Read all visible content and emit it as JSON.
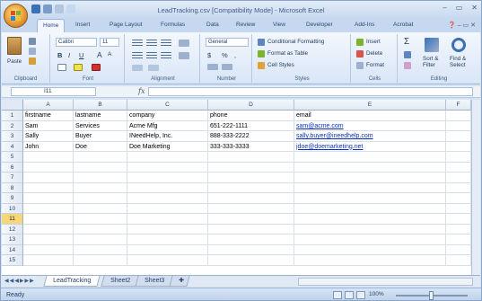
{
  "window": {
    "title": "LeadTracking.csv [Compatibility Mode] - Microsoft Excel",
    "controls": [
      "–",
      "▭",
      "✕"
    ]
  },
  "ribbon_tabs": [
    {
      "label": "Home",
      "active": true
    },
    {
      "label": "Insert"
    },
    {
      "label": "Page Layout"
    },
    {
      "label": "Formulas"
    },
    {
      "label": "Data"
    },
    {
      "label": "Review"
    },
    {
      "label": "View"
    },
    {
      "label": "Developer"
    },
    {
      "label": "Add-Ins"
    },
    {
      "label": "Acrobat"
    }
  ],
  "ribbon": {
    "clipboard": {
      "label": "Clipboard",
      "paste": "Paste"
    },
    "font": {
      "label": "Font",
      "name": "Calibri",
      "size": "11",
      "bold": "B",
      "italic": "I",
      "underline": "U",
      "grow": "A",
      "shrink": "A"
    },
    "alignment": {
      "label": "Alignment"
    },
    "number": {
      "label": "Number",
      "format": "General",
      "currency": "$",
      "percent": "%",
      "comma": ","
    },
    "styles": {
      "label": "Styles",
      "conditional": "Conditional Formatting",
      "format_table": "Format as Table",
      "cell_styles": "Cell Styles"
    },
    "cells": {
      "label": "Cells",
      "insert": "Insert",
      "delete": "Delete",
      "format": "Format"
    },
    "editing": {
      "label": "Editing",
      "sigma": "Σ",
      "sort": "Sort &",
      "filter": "Filter",
      "find": "Find &",
      "select": "Select"
    }
  },
  "formula_bar": {
    "name_box": "I11",
    "fx": "fx",
    "value": ""
  },
  "columns": [
    "A",
    "B",
    "C",
    "D",
    "E",
    "F"
  ],
  "rows": [
    {
      "num": "1",
      "cells": [
        "firstname",
        "lastname",
        "company",
        "phone",
        "email"
      ]
    },
    {
      "num": "2",
      "cells": [
        "Sam",
        "Services",
        "Acme Mfg",
        "651-222-1111",
        "sam@acme.com"
      ]
    },
    {
      "num": "3",
      "cells": [
        "Sally",
        "Buyer",
        "INeedHelp, Inc.",
        "888-333-2222",
        "sally.buyer@ineedhelp.com"
      ]
    },
    {
      "num": "4",
      "cells": [
        "John",
        "Doe",
        "Doe Marketing",
        "333-333-3333",
        "jdoe@doemarketing.net"
      ]
    },
    {
      "num": "5",
      "cells": [
        "",
        "",
        "",
        "",
        ""
      ]
    },
    {
      "num": "6",
      "cells": [
        "",
        "",
        "",
        "",
        ""
      ]
    },
    {
      "num": "7",
      "cells": [
        "",
        "",
        "",
        "",
        ""
      ]
    },
    {
      "num": "8",
      "cells": [
        "",
        "",
        "",
        "",
        ""
      ]
    },
    {
      "num": "9",
      "cells": [
        "",
        "",
        "",
        "",
        ""
      ]
    },
    {
      "num": "10",
      "cells": [
        "",
        "",
        "",
        "",
        ""
      ]
    },
    {
      "num": "11",
      "cells": [
        "",
        "",
        "",
        "",
        ""
      ],
      "selected": true
    },
    {
      "num": "12",
      "cells": [
        "",
        "",
        "",
        "",
        ""
      ]
    },
    {
      "num": "13",
      "cells": [
        "",
        "",
        "",
        "",
        ""
      ]
    },
    {
      "num": "14",
      "cells": [
        "",
        "",
        "",
        "",
        ""
      ]
    },
    {
      "num": "15",
      "cells": [
        "",
        "",
        "",
        "",
        ""
      ]
    }
  ],
  "sheets": [
    {
      "label": "LeadTracking",
      "active": true
    },
    {
      "label": "Sheet2"
    },
    {
      "label": "Sheet3"
    }
  ],
  "status": {
    "ready": "Ready",
    "zoom": "100%"
  },
  "colors": {
    "link": "#0b2fbd",
    "selected_row_header": "#f8d77a",
    "ribbon_bg": "#d9e6f6"
  }
}
